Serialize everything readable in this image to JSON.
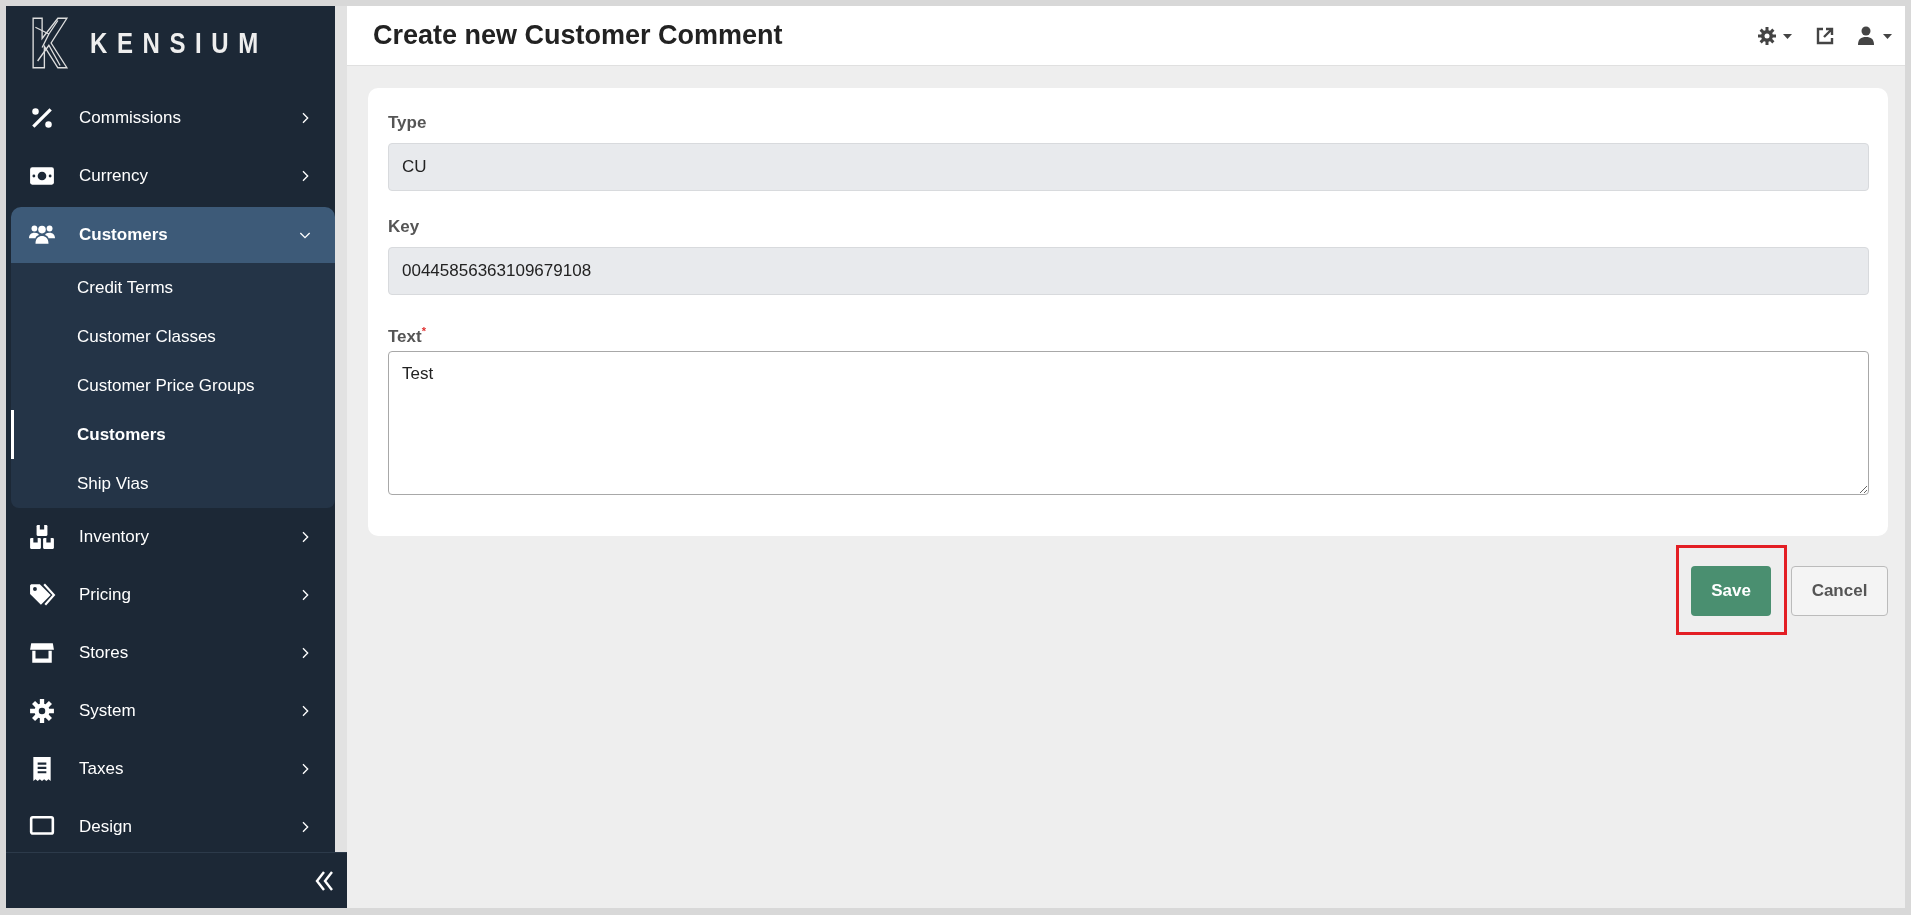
{
  "sidebar": {
    "logo": "KENSIUM",
    "items": [
      {
        "label": "Commissions",
        "expanded": false
      },
      {
        "label": "Currency",
        "expanded": false
      },
      {
        "label": "Customers",
        "expanded": true,
        "children": [
          {
            "label": "Credit Terms",
            "selected": false
          },
          {
            "label": "Customer Classes",
            "selected": false
          },
          {
            "label": "Customer Price Groups",
            "selected": false
          },
          {
            "label": "Customers",
            "selected": true
          },
          {
            "label": "Ship Vias",
            "selected": false
          }
        ]
      },
      {
        "label": "Inventory",
        "expanded": false
      },
      {
        "label": "Pricing",
        "expanded": false
      },
      {
        "label": "Stores",
        "expanded": false
      },
      {
        "label": "System",
        "expanded": false
      },
      {
        "label": "Taxes",
        "expanded": false
      },
      {
        "label": "Design",
        "expanded": false
      }
    ]
  },
  "page": {
    "title": "Create new Customer Comment"
  },
  "form": {
    "fields": [
      {
        "label": "Type",
        "value": "CU",
        "kind": "readonly",
        "required": false
      },
      {
        "label": "Key",
        "value": "00445856363109679108",
        "kind": "readonly",
        "required": false
      },
      {
        "label": "Text",
        "value": "Test",
        "kind": "textarea",
        "required": true,
        "required_mark": "*"
      }
    ]
  },
  "buttons": [
    {
      "label": "Save",
      "kind": "primary",
      "highlighted": true
    },
    {
      "label": "Cancel",
      "kind": "secondary",
      "highlighted": false
    }
  ]
}
